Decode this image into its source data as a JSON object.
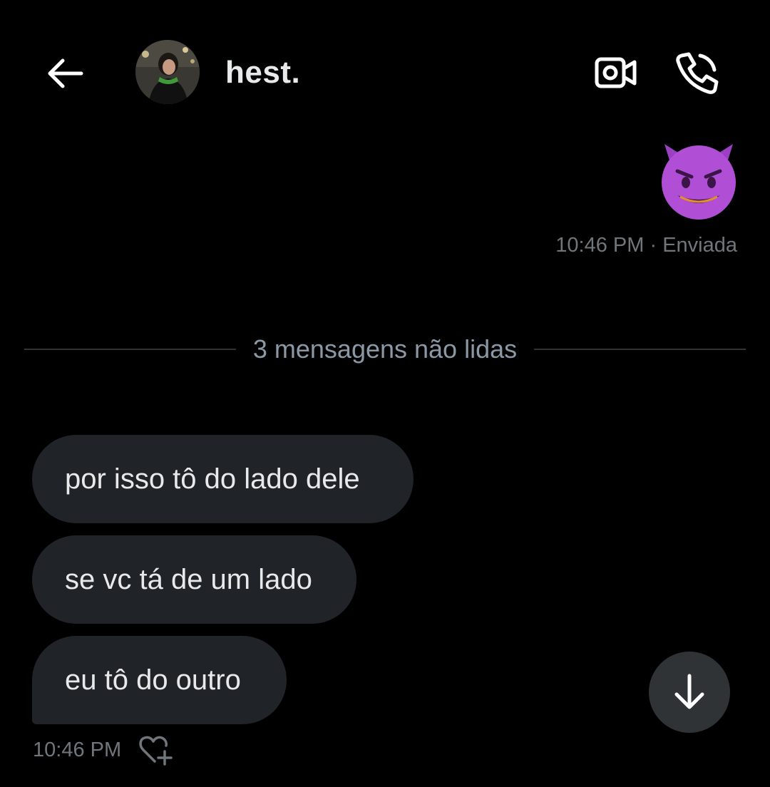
{
  "header": {
    "contact_name": "hest.",
    "back_icon": "arrow-left-icon",
    "video_icon": "video-camera-icon",
    "call_icon": "phone-icon"
  },
  "messages": {
    "sent": {
      "emoji": "smiling-face-with-horns",
      "time": "10:46 PM",
      "separator": "·",
      "status": "Enviada"
    },
    "unread_divider": "3 mensagens não lidas",
    "received": [
      {
        "text": "por isso tô do lado dele"
      },
      {
        "text": "se vc tá de um lado"
      },
      {
        "text": "eu tô do outro"
      }
    ],
    "received_time": "10:46 PM",
    "reaction_icon": "heart-plus-icon"
  },
  "scroll_button_icon": "arrow-down-icon",
  "colors": {
    "background": "#000000",
    "bubble": "#202327",
    "text": "#e7e9ea",
    "muted": "#71767b",
    "emoji_purple": "#b04fd6"
  }
}
